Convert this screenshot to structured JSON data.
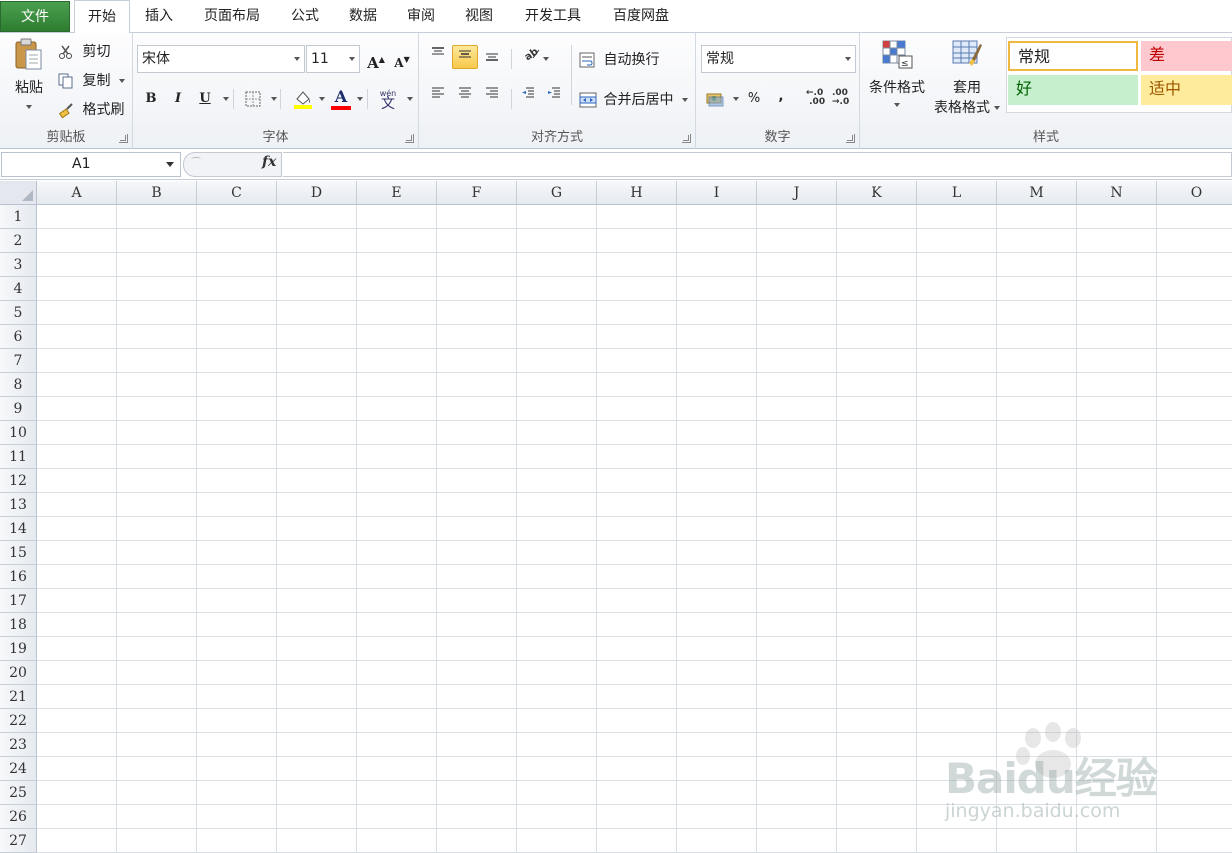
{
  "tabs": [
    {
      "label": "文件"
    },
    {
      "label": "开始"
    },
    {
      "label": "插入"
    },
    {
      "label": "页面布局"
    },
    {
      "label": "公式"
    },
    {
      "label": "数据"
    },
    {
      "label": "审阅"
    },
    {
      "label": "视图"
    },
    {
      "label": "开发工具"
    },
    {
      "label": "百度网盘"
    }
  ],
  "active_tab": "开始",
  "clipboard": {
    "paste": "粘贴",
    "cut": "剪切",
    "copy": "复制",
    "format_painter": "格式刷",
    "group": "剪贴板"
  },
  "font": {
    "name": "宋体",
    "size": "11",
    "group": "字体",
    "bold": "B",
    "italic": "I",
    "underline": "U",
    "grow": "A",
    "shrink": "A",
    "fill_color": "#ffff00",
    "font_color": "#ff0000"
  },
  "alignment": {
    "wrap": "自动换行",
    "merge": "合并后居中",
    "group": "对齐方式"
  },
  "number": {
    "format": "常规",
    "percent": "%",
    "comma": ",",
    "inc_decimal": ".0\n.00",
    "dec_decimal": ".00\n.0",
    "group": "数字"
  },
  "styles": {
    "conditional": "条件格式",
    "table_line1": "套用",
    "table_line2": "表格格式",
    "normal": "常规",
    "bad": "差",
    "good": "好",
    "neutral": "适中",
    "group": "样式",
    "colors": {
      "normal_border": "#f0b840",
      "bad_bg": "#ffc7ce",
      "bad_fg": "#c00000",
      "good_bg": "#c6efce",
      "good_fg": "#006100",
      "neutral_bg": "#ffeb9c",
      "neutral_fg": "#9c5700"
    }
  },
  "namebox": "A1",
  "fx": "fx",
  "columns": [
    "A",
    "B",
    "C",
    "D",
    "E",
    "F",
    "G",
    "H",
    "I",
    "J",
    "K",
    "L",
    "M",
    "N",
    "O"
  ],
  "rows": [
    "1",
    "2",
    "3",
    "4",
    "5",
    "6",
    "7",
    "8",
    "9",
    "10",
    "11",
    "12",
    "13",
    "14",
    "15",
    "16",
    "17",
    "18",
    "19",
    "20",
    "21",
    "22",
    "23",
    "24",
    "25",
    "26",
    "27"
  ],
  "watermark": {
    "main": "Baidu经验",
    "sub": "jingyan.baidu.com"
  }
}
